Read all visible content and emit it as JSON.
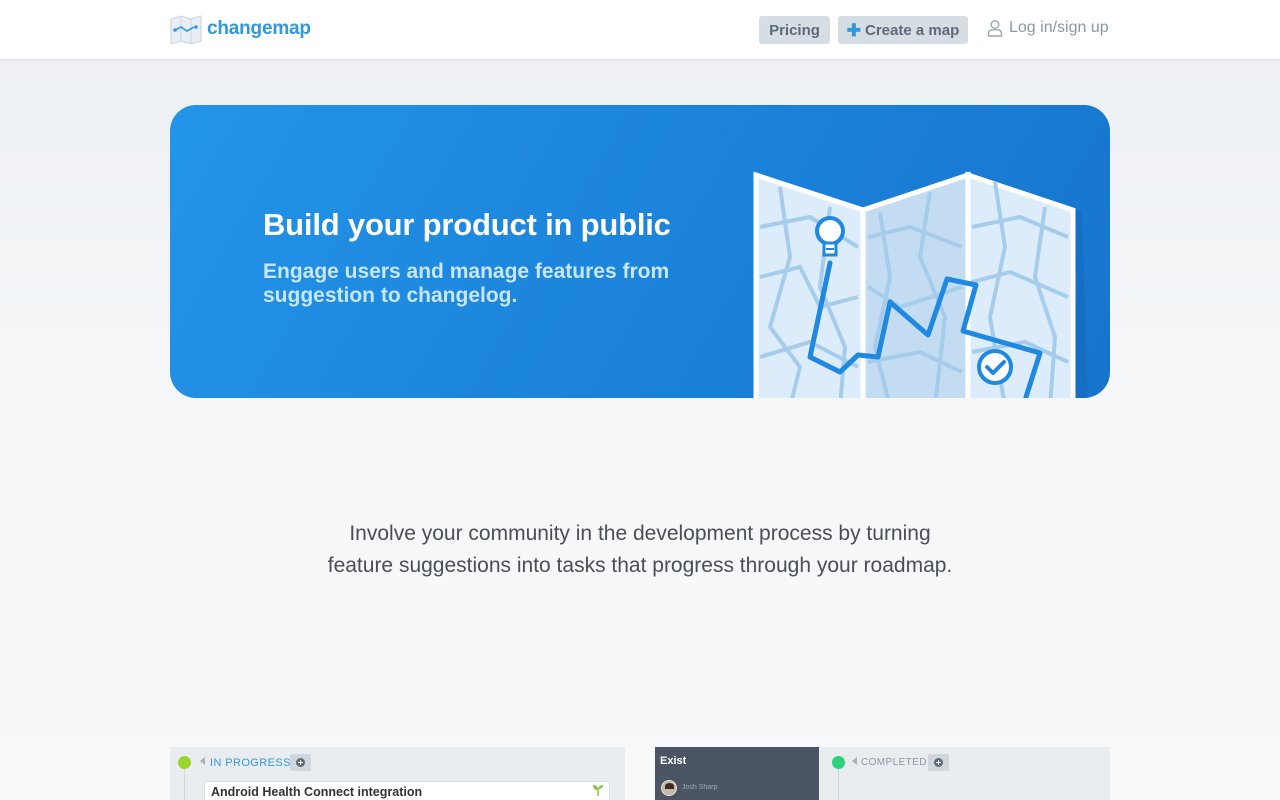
{
  "header": {
    "brand": "changemap",
    "pricing_label": "Pricing",
    "create_label": "Create a map",
    "login_label": "Log in/sign up"
  },
  "hero": {
    "title": "Build your product in public",
    "subtitle": "Engage users and manage features from suggestion to changelog."
  },
  "intro": {
    "text": "Involve your community in the development process by turning feature suggestions into tasks that progress through your roadmap."
  },
  "previews": {
    "left": {
      "status": "IN PROGRESS",
      "card_title": "Android Health Connect integration"
    },
    "right": {
      "panel_title": "Exist",
      "author": "Josh Sharp",
      "status": "COMPLETED"
    }
  },
  "icons": {
    "logo": "folded-map-logo",
    "create": "plus-icon",
    "login": "user-icon",
    "hero_art": "folded-map-illustration",
    "idea": "lightbulb-icon",
    "done": "check-circle-icon",
    "add": "add-circle-icon",
    "sprout": "sprout-icon"
  },
  "colors": {
    "brand": "#2f98de",
    "hero_bg": "#1f8ae2",
    "hero_subtitle": "#c7e6ff",
    "in_progress": "#9bd42a",
    "completed": "#2ed07a"
  }
}
